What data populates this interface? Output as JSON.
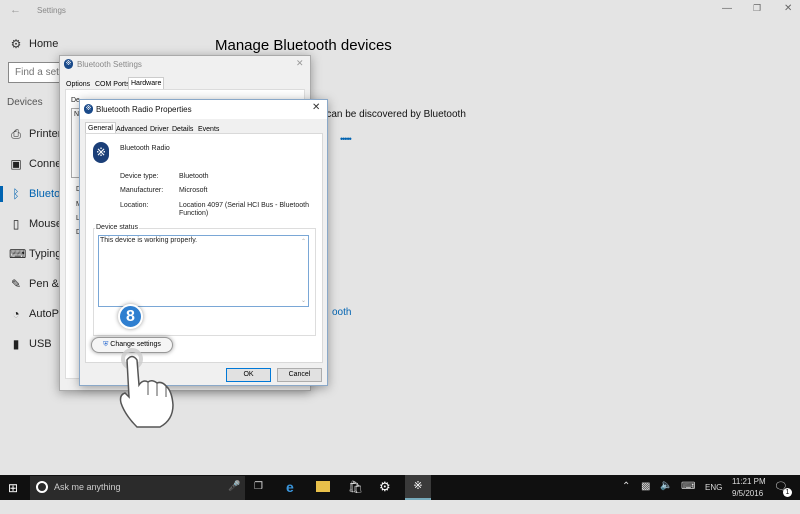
{
  "window": {
    "title": "Settings",
    "back_icon": "arrow-left-icon"
  },
  "sidebar": {
    "home": "Home",
    "search_placeholder": "Find a setti",
    "section": "Devices",
    "items": [
      {
        "label": "Printers",
        "icon": "printer-icon"
      },
      {
        "label": "Connec",
        "icon": "devices-icon"
      },
      {
        "label": "Blueto",
        "icon": "bluetooth-icon",
        "active": true
      },
      {
        "label": "Mouse",
        "icon": "mouse-icon"
      },
      {
        "label": "Typing",
        "icon": "keyboard-icon"
      },
      {
        "label": "Pen & W",
        "icon": "pen-icon"
      },
      {
        "label": "AutoPla",
        "icon": "autoplay-icon"
      },
      {
        "label": "USB",
        "icon": "usb-icon"
      }
    ]
  },
  "main": {
    "title": "Manage Bluetooth devices",
    "discover_text": "d can be discovered by Bluetooth",
    "progress_dots": "•••••",
    "link": "ooth"
  },
  "bt_settings": {
    "title": "Bluetooth Settings",
    "tabs": [
      "Options",
      "COM Ports",
      "Hardware"
    ],
    "active_tab": "Hardware",
    "list_label": "De",
    "col": "N",
    "letters": [
      "D",
      "M",
      "L",
      "D"
    ]
  },
  "radio_props": {
    "title": "Bluetooth Radio Properties",
    "tabs": [
      "General",
      "Advanced",
      "Driver",
      "Details",
      "Events"
    ],
    "active_tab": "General",
    "device_name": "Bluetooth Radio",
    "fields": [
      {
        "label": "Device type:",
        "value": "Bluetooth"
      },
      {
        "label": "Manufacturer:",
        "value": "Microsoft"
      },
      {
        "label": "Location:",
        "value": "Location 4097 (Serial HCI Bus - Bluetooth",
        "value2": "Function)"
      }
    ],
    "status_label": "Device status",
    "status_text": "This device is working properly.",
    "change_settings": "Change settings",
    "ok": "OK",
    "cancel": "Cancel"
  },
  "overlay": {
    "step": "8"
  },
  "taskbar": {
    "search_placeholder": "Ask me anything",
    "lang": "ENG",
    "time": "11:21 PM",
    "date": "9/5/2016",
    "notifications": "1"
  },
  "colors": {
    "accent": "#0063b1",
    "taskbar": "#101010"
  }
}
